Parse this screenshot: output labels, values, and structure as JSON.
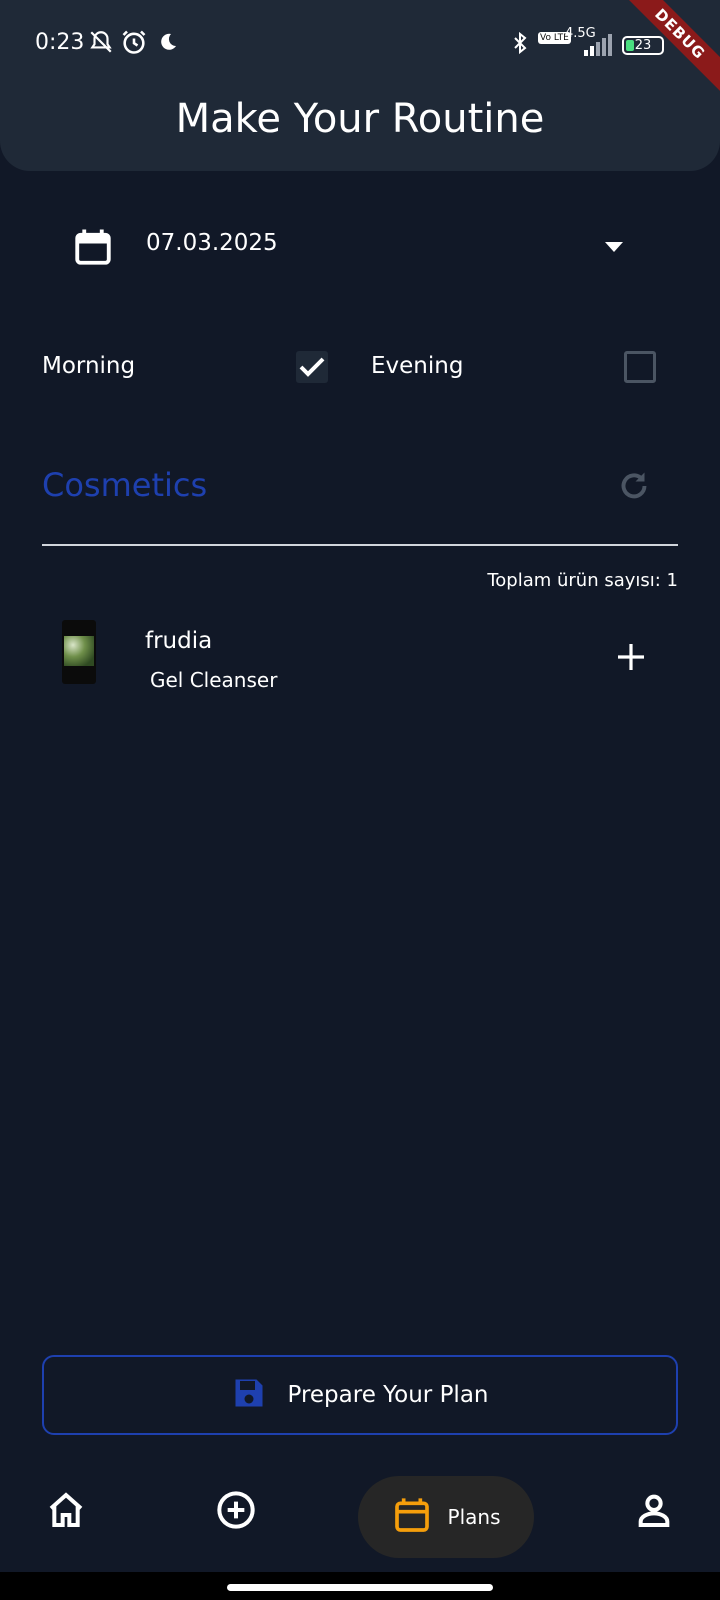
{
  "status_bar": {
    "time": "0:23",
    "network": "4.5G",
    "volte": "Vo LTE",
    "battery": "23",
    "icons": [
      "bell-off-icon",
      "alarm-icon",
      "moon-icon",
      "bluetooth-icon",
      "signal-icon",
      "battery-icon"
    ]
  },
  "debug_banner": "DEBUG",
  "header": {
    "title": "Make Your Routine"
  },
  "date_picker": {
    "value": "07.03.2025",
    "icon": "calendar-icon"
  },
  "time_of_day": {
    "morning": {
      "label": "Morning",
      "checked": true
    },
    "evening": {
      "label": "Evening",
      "checked": false
    }
  },
  "cosmetics": {
    "title": "Cosmetics",
    "title_color": "#1e40af",
    "count_text": "Toplam ürün sayısı: 1",
    "items": [
      {
        "brand": "frudia",
        "name": "Gel Cleanser"
      }
    ]
  },
  "actions": {
    "prepare_label": "Prepare Your Plan",
    "accent": "#1e40af"
  },
  "bottom_nav": {
    "items": [
      {
        "icon": "home-icon",
        "label": ""
      },
      {
        "icon": "add-circle-icon",
        "label": ""
      },
      {
        "icon": "calendar-icon",
        "label": "Plans",
        "active": true,
        "color": "#f59e0b"
      },
      {
        "icon": "person-icon",
        "label": ""
      }
    ]
  },
  "colors": {
    "background": "#111827",
    "appbar": "#1f2937"
  }
}
